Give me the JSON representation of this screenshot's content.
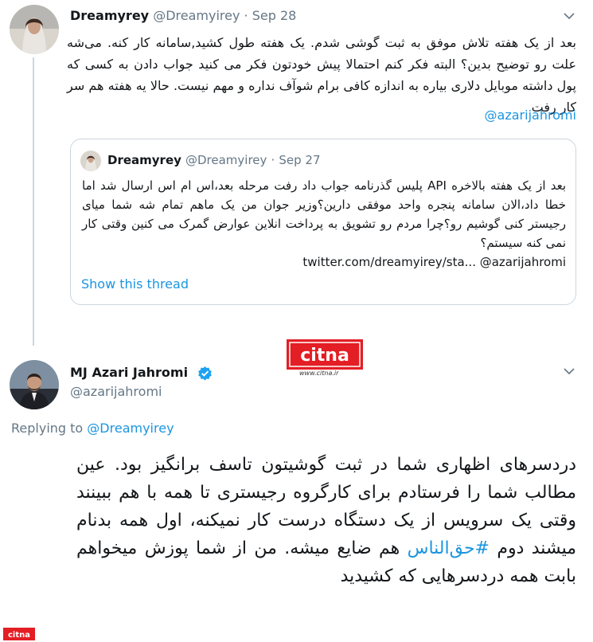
{
  "tweet1": {
    "name": "Dreamyrey",
    "handle": "@Dreamyirey",
    "dot": "·",
    "date": "Sep 28",
    "text": "بعد از یک هفته تلاش موفق به ثبت گوشی شدم. یک هفته طول کشید,سامانه کار کنه. می‌شه علت رو توضیح بدین؟ البته فکر کنم احتمالا پیش خودتون فکر می کنید جواب دادن به کسی که پول داشته موبایل دلاری بیاره به اندازه کافی برام شوآف نداره و مهم نیست. حالا یه هفته هم سر کار رفت",
    "mention": "@azarijahromi"
  },
  "quote": {
    "name": "Dreamyrey",
    "handle": "@Dreamyirey",
    "dot": "·",
    "date": "Sep 27",
    "text": "بعد از یک هفته بالاخره API پلیس گذرنامه جواب داد رفت مرحله بعد،اس ام اس ارسال شد اما خطا داد،الان سامانه پنجره واحد موفقی دارین؟وزیر جوان من یک ماهم تمام شه شما میای رجیستر کنی گوشیم رو؟چرا مردم رو تشویق به پرداخت انلاین عوارض گمرک می کنین وقتی کار نمی کنه سیستم؟",
    "link_line": "twitter.com/dreamyirey/sta... @azarijahromi",
    "show_thread": "Show this thread"
  },
  "logo": {
    "text": "citna",
    "url": "www.citna.ir",
    "color": "#e31e24"
  },
  "tweet2": {
    "name": "MJ Azari Jahromi",
    "handle": "@azarijahromi",
    "replying_prefix": "Replying to ",
    "replying_to": "@Dreamyirey",
    "text_before_hashtag": "دردسرهای اظهاری شما در ثبت گوشیتون تاسف برانگیز بود. عین مطالب شما را فرستادم برای کارگروه رجیستری تا همه با هم ببینند وقتی یک سرویس از یک دستگاه درست کار نمیکنه، اول همه بدنام میشند دوم ",
    "hashtag": "#حق‌الناس",
    "text_after_hashtag": " هم ضایع میشه. من از شما پوزش میخواهم بابت همه دردسرهایی که کشیدید"
  },
  "colors": {
    "link": "#1b95e0",
    "secondary": "#657786",
    "border": "#ccd6dd",
    "verified": "#1da1f2"
  }
}
